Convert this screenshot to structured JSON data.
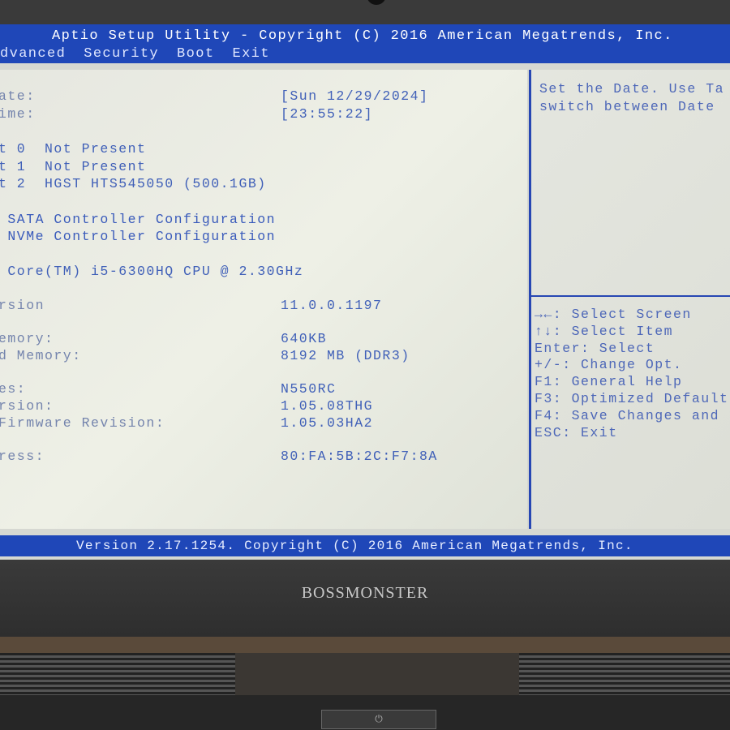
{
  "title": "Aptio Setup Utility - Copyright (C) 2016 American Megatrends, Inc.",
  "menu": [
    "dvanced",
    "Security",
    "Boot",
    "Exit"
  ],
  "rows": [
    {
      "label": "ate:",
      "value": "[Sun 12/29/2024]"
    },
    {
      "label": "ime:",
      "value": "[23:55:22]"
    },
    {
      "label": "t 0  Not Present",
      "value": ""
    },
    {
      "label": "t 1  Not Present",
      "value": ""
    },
    {
      "label": "t 2  HGST HTS545050 (500.1GB)",
      "value": ""
    },
    {
      "label": " SATA Controller Configuration",
      "value": ""
    },
    {
      "label": " NVMe Controller Configuration",
      "value": ""
    },
    {
      "label": " Core(TM) i5-6300HQ CPU @ 2.30GHz",
      "value": ""
    },
    {
      "label": "rsion",
      "value": "11.0.0.1197"
    },
    {
      "label": "emory:",
      "value": "640KB"
    },
    {
      "label": "d Memory:",
      "value": "8192 MB (DDR3)"
    },
    {
      "label": "es:",
      "value": "N550RC"
    },
    {
      "label": "rsion:",
      "value": "1.05.08THG"
    },
    {
      "label": "Firmware Revision:",
      "value": "1.05.03HA2"
    },
    {
      "label": "ress:",
      "value": "80:FA:5B:2C:F7:8A"
    }
  ],
  "help": {
    "description": [
      "Set the Date. Use Ta",
      "switch between Date"
    ],
    "keys": [
      "→←: Select Screen",
      "↑↓: Select Item",
      "Enter: Select",
      "+/-: Change Opt.",
      "F1: General Help",
      "F3: Optimized Default",
      "F4: Save Changes and",
      "ESC: Exit"
    ]
  },
  "footer": "Version 2.17.1254. Copyright (C) 2016 American Megatrends, Inc.",
  "brand": "BOSSMONSTER",
  "colors": {
    "bar": "#1f47b8",
    "background": "#e6e7e0",
    "text": "#4060b8"
  }
}
